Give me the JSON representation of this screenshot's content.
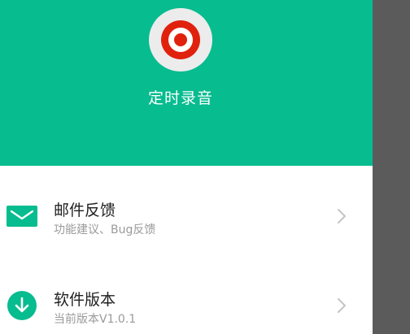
{
  "header": {
    "app_title": "定时录音",
    "background_color": "#07bc8f",
    "logo_icon": "record-target-icon",
    "logo_color": "#e0210d"
  },
  "menu": {
    "items": [
      {
        "title": "邮件反馈",
        "subtitle": "功能建议、Bug反馈",
        "icon": "mail-icon"
      },
      {
        "title": "软件版本",
        "subtitle": "当前版本V1.0.1",
        "icon": "download-icon"
      }
    ]
  },
  "colors": {
    "accent": "#07bc8f",
    "scrim": "#5b5b5b"
  }
}
